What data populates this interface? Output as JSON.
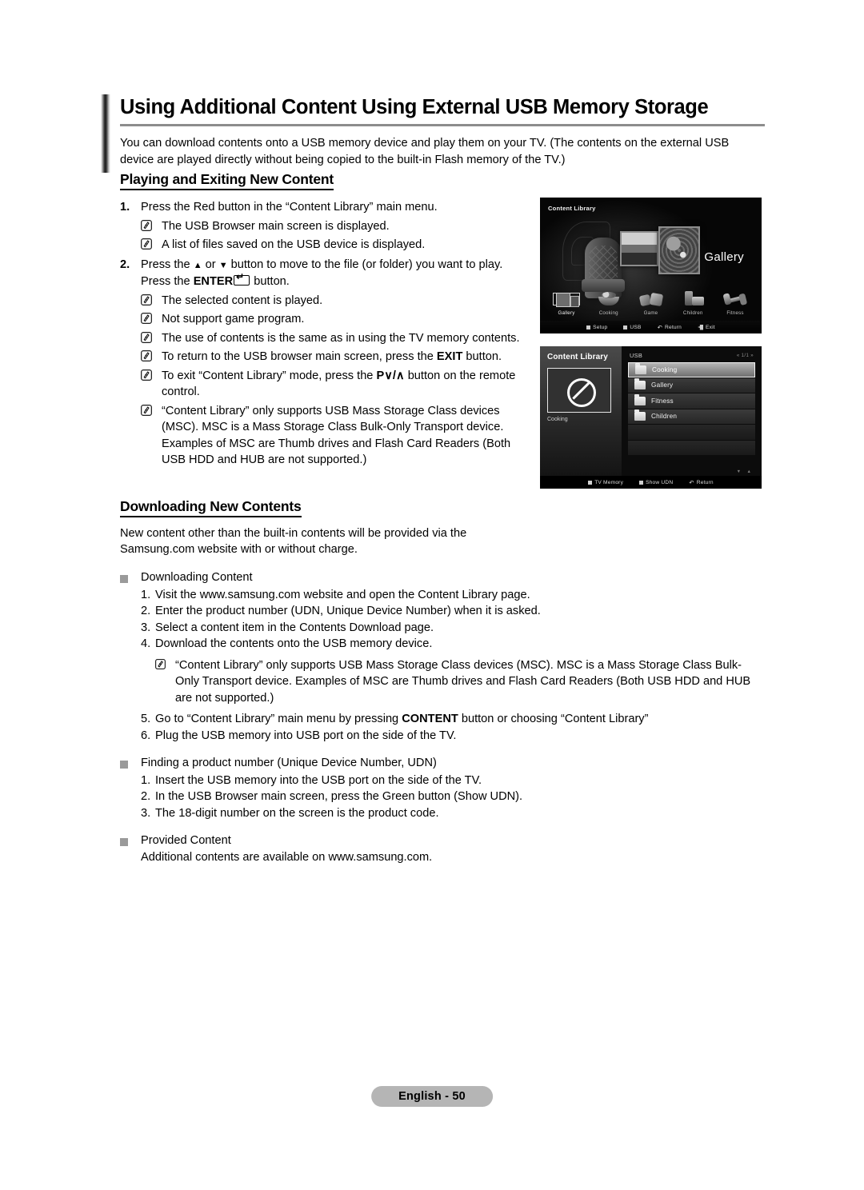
{
  "page": {
    "title": "Using Additional Content Using External USB Memory Storage",
    "intro": "You can download contents onto a USB memory device and play them on your TV. (The contents on the external USB device are played directly without being copied to the built-in Flash memory of the TV.)",
    "footer_label": "English - 50"
  },
  "section1": {
    "heading": "Playing and Exiting New Content",
    "step1": {
      "num": "1.",
      "text": "Press the Red button in the “Content Library” main menu.",
      "notes": [
        "The USB Browser main screen is displayed.",
        "A list of files saved on the USB device is displayed."
      ]
    },
    "step2": {
      "num": "2.",
      "line1_a": "Press the ",
      "line1_b": " or ",
      "line1_c": " button to move to the file (or folder) you want to play.",
      "line2_a": "Press the ",
      "line2_bold": "ENTER",
      "line2_b": " button.",
      "notes": [
        "The selected content is played.",
        "Not support game program.",
        "The use of contents is the same as in using the TV memory contents."
      ],
      "note_exit_a": "To return to the USB browser main screen, press the ",
      "note_exit_bold": "EXIT",
      "note_exit_b": " button.",
      "note_pv_a": "To exit “Content Library” mode, press the ",
      "note_pv_glyph": "P∨/∧",
      "note_pv_b": " button on the remote control.",
      "note_msc": "“Content Library” only supports USB Mass Storage Class devices (MSC). MSC is a Mass Storage Class Bulk-Only Transport device. Examples of MSC are Thumb drives and Flash Card Readers (Both USB HDD and HUB are not supported.)"
    }
  },
  "section2": {
    "heading": "Downloading New Contents",
    "intro": "New content other than the built-in contents will be provided via the Samsung.com website with or without charge.",
    "groups": [
      {
        "title": "Downloading Content",
        "items": [
          {
            "num": "1.",
            "text": "Visit the www.samsung.com website and open the Content Library page."
          },
          {
            "num": "2.",
            "text": "Enter the product number (UDN, Unique Device Number) when it is asked."
          },
          {
            "num": "3.",
            "text": "Select a content item in the Contents Download page."
          },
          {
            "num": "4.",
            "text": "Download the contents onto the USB memory device."
          }
        ],
        "note": "“Content Library” only supports USB Mass Storage Class devices (MSC). MSC is a Mass Storage Class Bulk-Only Transport device. Examples of MSC are Thumb drives and Flash Card Readers (Both USB HDD and HUB are not supported.)",
        "items_after": [
          {
            "num": "5.",
            "text_a": "Go to “Content Library” main menu by pressing ",
            "bold": "CONTENT",
            "text_b": " button or choosing “Content Library”"
          },
          {
            "num": "6.",
            "text": "Plug the USB memory into USB port on the side of the TV."
          }
        ]
      },
      {
        "title": "Finding a product number (Unique Device Number, UDN)",
        "items": [
          {
            "num": "1.",
            "text": "Insert the USB memory into the USB port on the side of the TV."
          },
          {
            "num": "2.",
            "text": "In the USB Browser main screen, press the Green button (Show UDN)."
          },
          {
            "num": "3.",
            "text": "The 18-digit number on the screen is the product code."
          }
        ]
      },
      {
        "title": "Provided Content",
        "plain": "Additional contents are available on www.samsung.com."
      }
    ]
  },
  "tv_screen_1": {
    "title": "Content Library",
    "selected_label": "Gallery",
    "categories": [
      {
        "label": "Gallery",
        "icon": "gallery-icon",
        "selected": true
      },
      {
        "label": "Cooking",
        "icon": "cooking-icon",
        "selected": false
      },
      {
        "label": "Game",
        "icon": "game-icon",
        "selected": false
      },
      {
        "label": "Children",
        "icon": "children-icon",
        "selected": false
      },
      {
        "label": "Fitness",
        "icon": "fitness-icon",
        "selected": false
      }
    ],
    "bottom_bar": [
      {
        "label": "Setup",
        "marker": "square"
      },
      {
        "label": "USB",
        "marker": "square"
      },
      {
        "label": "Return",
        "marker": "return"
      },
      {
        "label": "Exit",
        "marker": "exit"
      }
    ]
  },
  "tv_screen_2": {
    "title": "Content Library",
    "preview_caption": "Cooking",
    "preview_icon": "no-entry-icon",
    "source_label": "USB",
    "pagination": "« 1/1 »",
    "folders": [
      {
        "name": "Cooking",
        "selected": true
      },
      {
        "name": "Gallery",
        "selected": false
      },
      {
        "name": "Fitness",
        "selected": false
      },
      {
        "name": "Children",
        "selected": false
      }
    ],
    "empty_rows": 2,
    "scroll_indicator": "▼ ▲",
    "bottom_bar": [
      {
        "label": "TV Memory",
        "marker": "square"
      },
      {
        "label": "Show UDN",
        "marker": "square"
      },
      {
        "label": "Return",
        "marker": "return"
      }
    ]
  }
}
